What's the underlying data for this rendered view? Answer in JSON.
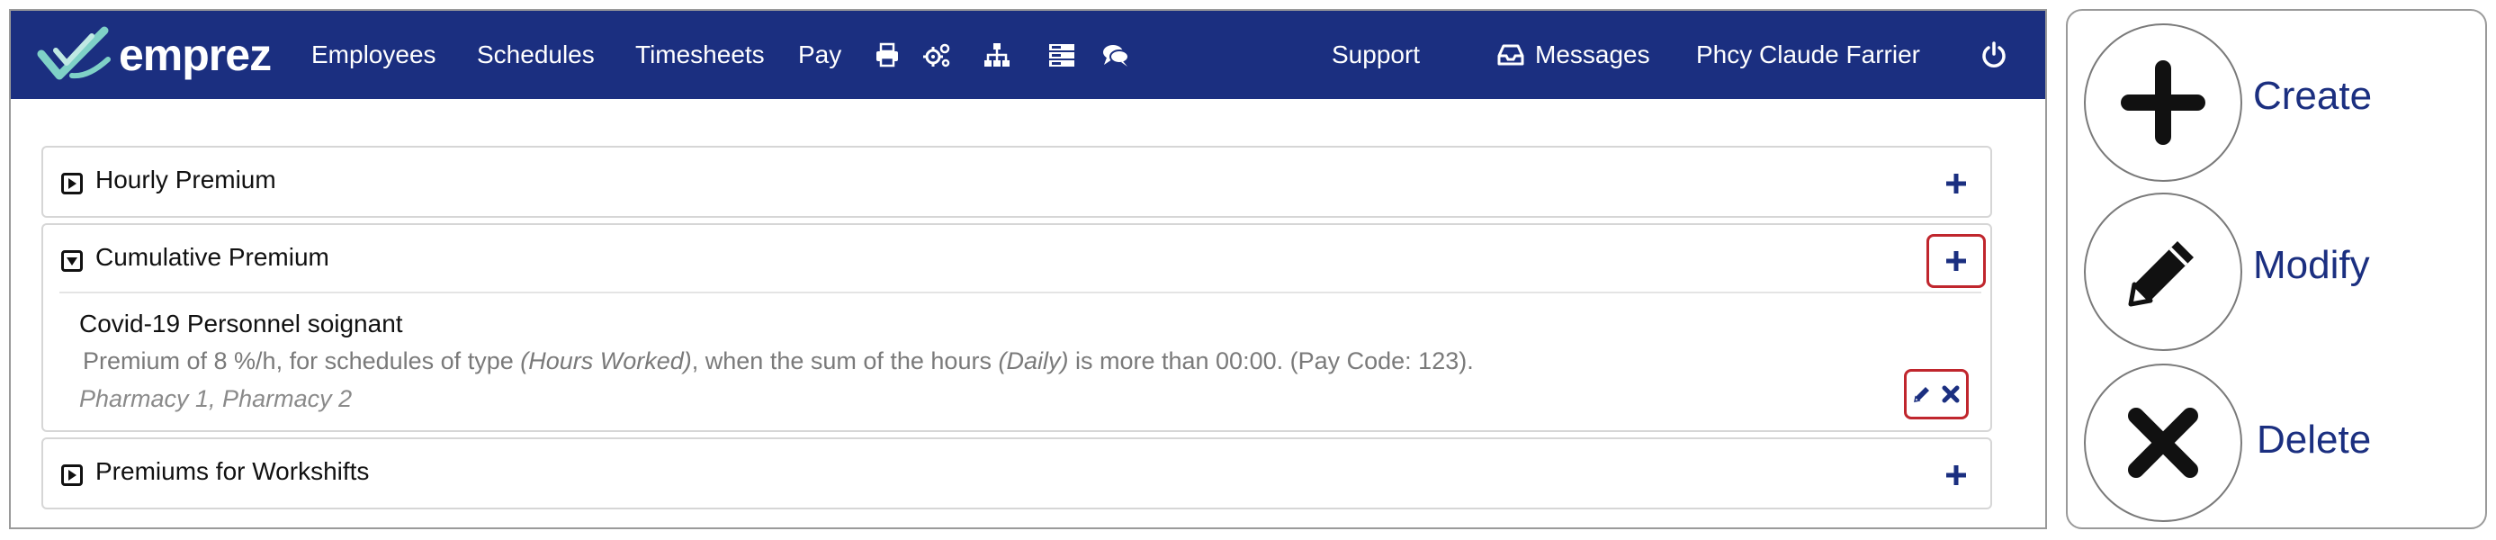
{
  "navbar": {
    "logo_text": "emprez",
    "items": [
      "Employees",
      "Schedules",
      "Timesheets",
      "Pay"
    ],
    "icons": [
      "printer-icon",
      "gears-icon",
      "sitemap-icon",
      "server-icon",
      "comments-icon"
    ],
    "support": "Support",
    "messages": "Messages",
    "user": "Phcy Claude Farrier",
    "power_icon": "power-icon"
  },
  "panels": [
    {
      "title": "Hourly Premium",
      "expanded": false
    },
    {
      "title": "Cumulative Premium",
      "expanded": true,
      "item": {
        "title": "Covid-19 Personnel soignant",
        "desc_a": "Premium of 8 %/h, for schedules of type ",
        "desc_b": "(Hours Worked)",
        "desc_c": ", when the sum of the hours ",
        "desc_d": "(Daily)",
        "desc_e": " is more than 00:00. (Pay Code: 123).",
        "places": "Pharmacy 1, Pharmacy 2"
      }
    },
    {
      "title": "Premiums for Workshifts",
      "expanded": false
    }
  ],
  "legend": {
    "create": "Create",
    "modify": "Modify",
    "delete": "Delete"
  },
  "colors": {
    "navbar": "#1b2f80",
    "highlight": "#c0262d",
    "legend_text": "#1b2f80"
  }
}
